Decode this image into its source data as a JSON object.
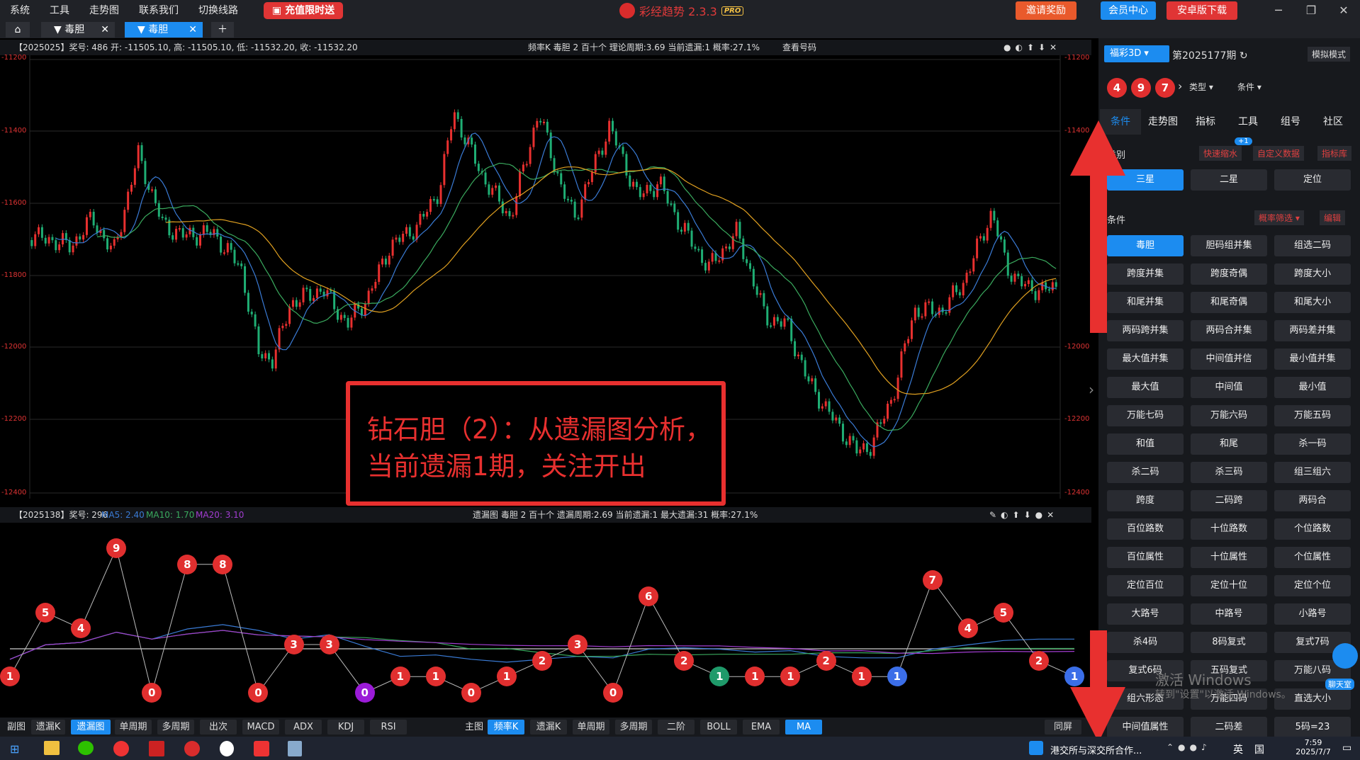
{
  "menu": [
    "系统",
    "工具",
    "走势图",
    "联系我们",
    "切换线路"
  ],
  "promo": "充值限时送",
  "app_title": "彩经趋势 2.3.3",
  "app_badge": "PRO",
  "topright": {
    "invite": "邀请奖励",
    "member": "会员中心",
    "android": "安卓版下载"
  },
  "tabs": [
    {
      "label": "毒胆"
    },
    {
      "label": "毒胆"
    }
  ],
  "main_header": {
    "left": "【2025025】奖号: 486  开: -11505.10, 高: -11505.10, 低: -11532.20, 收: -11532.20",
    "mid": "频率K  毒胆  2  百十个  理论周期:3.69  当前遗漏:1  概率:27.1%",
    "check": "查看号码"
  },
  "sub_header": {
    "left": "【2025138】奖号: 296",
    "ma5": "MA5: 2.40",
    "ma10": "MA10: 1.70",
    "ma20": "MA20: 3.10",
    "mid": "遗漏图  毒胆  2  百十个  遗漏周期:2.69  当前遗漏:1  最大遗漏:31  概率:27.1%"
  },
  "y_ticks": [
    "-11200",
    "-11400",
    "-11600",
    "-11800",
    "-12000",
    "-12200",
    "-12400"
  ],
  "overlay": {
    "line1": "钻石胆（2）：从遗漏图分析，",
    "line2": "当前遗漏1期，关注开出"
  },
  "chart_data": {
    "type": "line",
    "title": "遗漏图",
    "x": [
      1,
      2,
      3,
      4,
      5,
      6,
      7,
      8,
      9,
      10,
      11,
      12,
      13,
      14,
      15,
      16,
      17,
      18,
      19,
      20,
      21,
      22,
      23,
      24,
      25,
      26,
      27,
      28,
      29,
      30,
      31
    ],
    "values": [
      1,
      5,
      4,
      9,
      0,
      8,
      8,
      0,
      3,
      3,
      0,
      1,
      1,
      0,
      1,
      2,
      3,
      0,
      6,
      2,
      1,
      1,
      1,
      2,
      1,
      1,
      7,
      4,
      5,
      2,
      1
    ],
    "ylim": [
      0,
      10
    ]
  },
  "balls": [
    "1",
    "5",
    "4",
    "9",
    "0",
    "8",
    "8",
    "0",
    "3",
    "3",
    "0",
    "1",
    "1",
    "0",
    "1",
    "2",
    "3",
    "0",
    "6",
    "2",
    "1",
    "1",
    "1",
    "2",
    "1",
    "1",
    "7",
    "4",
    "5",
    "2",
    "1"
  ],
  "bottom_left": [
    "副图",
    "遗漏K",
    "遗漏图",
    "单周期",
    "多周期",
    "出次",
    "MACD",
    "ADX",
    "KDJ",
    "RSI"
  ],
  "bottom_right": [
    "主图",
    "频率K",
    "遗漏K",
    "单周期",
    "多周期",
    "二阶",
    "BOLL",
    "EMA",
    "MA"
  ],
  "bottom_far": "同屏",
  "right": {
    "lottery": "福彩3D",
    "period": "第2025177期",
    "mode": "模拟模式",
    "balls": [
      "4",
      "9",
      "7"
    ],
    "type": "类型",
    "cond": "条件",
    "tabs": [
      "条件",
      "走势图",
      "指标",
      "工具",
      "组号",
      "社区"
    ],
    "cat_label": "类别",
    "quick": "快速缩水",
    "quick_badge": "+1",
    "custom": "自定义数据",
    "lib": "指标库",
    "cats": [
      "三星",
      "二星",
      "定位"
    ],
    "cond_label": "条件",
    "filter": "概率筛选",
    "edit": "编辑",
    "grid": [
      "毒胆",
      "胆码组并集",
      "组选二码",
      "跨度并集",
      "跨度奇偶",
      "跨度大小",
      "和尾并集",
      "和尾奇偶",
      "和尾大小",
      "两码跨并集",
      "两码合并集",
      "两码差并集",
      "最大值并集",
      "中间值并信",
      "最小值并集",
      "最大值",
      "中间值",
      "最小值",
      "万能七码",
      "万能六码",
      "万能五码",
      "和值",
      "和尾",
      "杀一码",
      "杀二码",
      "杀三码",
      "组三组六",
      "跨度",
      "二码跨",
      "两码合",
      "百位路数",
      "十位路数",
      "个位路数",
      "百位属性",
      "十位属性",
      "个位属性",
      "定位百位",
      "定位十位",
      "定位个位",
      "大路号",
      "中路号",
      "小路号",
      "杀4码",
      "8码复式",
      "复式7码",
      "复式6码",
      "五码复式",
      "万能八码",
      "组六形态",
      "万能四码",
      "直选大小",
      "中间值属性",
      "二码差",
      "5码=23"
    ],
    "chat": "聊天室"
  },
  "watermark": {
    "line1": "激活 Windows",
    "line2": "转到\"设置\"以激活 Windows。"
  },
  "taskbar": {
    "news": "港交所与深交所合作...",
    "ime": "英",
    "ime2": "国",
    "time": "7:59",
    "date": "2025/7/7"
  }
}
